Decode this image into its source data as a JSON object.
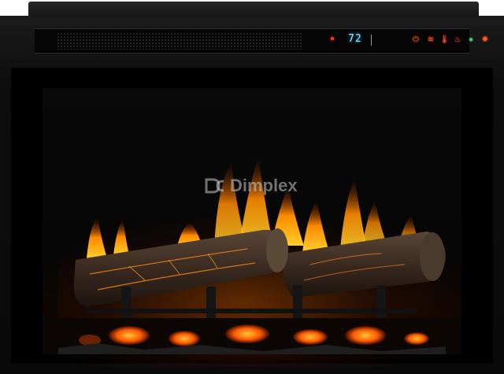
{
  "brand": {
    "name": "Dimplex"
  },
  "control_panel": {
    "temperature": "72",
    "indicator_color": "#ff3b1f",
    "display_color": "#7fe8ff",
    "controls": [
      {
        "icon": "power-icon",
        "glyph": "⏻"
      },
      {
        "icon": "flame-level-icon",
        "glyph": "≋"
      },
      {
        "icon": "thermometer-icon",
        "glyph": "🌡"
      },
      {
        "icon": "heat-icon",
        "glyph": "♨"
      },
      {
        "icon": "ember-color-icon",
        "glyph": "●"
      },
      {
        "icon": "brightness-icon",
        "glyph": "✹"
      }
    ]
  },
  "colors": {
    "frame": "#0d0d0d",
    "flame_core": "#ffb400",
    "flame_outer": "#ff5a00",
    "log": "#3a2a20"
  }
}
